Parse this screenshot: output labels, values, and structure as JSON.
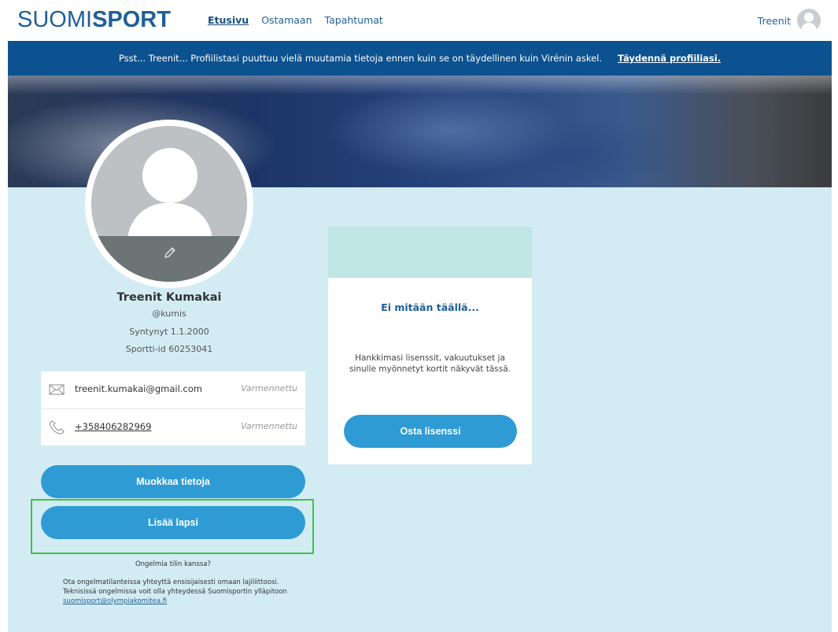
{
  "header": {
    "logo_light": "SUOMI",
    "logo_bold": "SPORT",
    "nav": [
      {
        "label": "Etusivu",
        "active": true
      },
      {
        "label": "Ostamaan",
        "active": false
      },
      {
        "label": "Tapahtumat",
        "active": false
      }
    ],
    "user_name": "Treenit"
  },
  "notice": {
    "text": "Psst... Treenit... Profiilistasi puuttuu vielä muutamia tietoja ennen kuin se on täydellinen kuin Virénin askel.",
    "link": "Täydennä profiiliasi."
  },
  "profile": {
    "name": "Treenit Kumakai",
    "handle": "@kumis",
    "born": "Syntynyt 1.1.2000",
    "sportti_id": "Sportti-id 60253041",
    "email": "treenit.kumakai@gmail.com",
    "email_status": "Varmennettu",
    "phone": "+358406282969",
    "phone_status": "Varmennettu",
    "edit_button": "Muokkaa tietoja",
    "add_child_button": "Lisää lapsi"
  },
  "help": {
    "title": "Ongelmia tilin kanssa?",
    "body": "Ota ongelmatilanteissa yhteyttä ensisijaisesti omaan lajiliittoosi. Teknisissä ongelmissa voit olla yhteydessä Suomisportin ylläpitoon",
    "email": "suomisport@olympiakomitea.fi"
  },
  "license": {
    "title": "Ei mitään täällä...",
    "description": "Hankkimasi lisenssit, vakuutukset ja sinulle myönnetyt kortit näkyvät tässä.",
    "button": "Osta lisenssi"
  },
  "colors": {
    "brand": "#1e5f97",
    "notice_bg": "#0c5290",
    "button": "#2f9bd5",
    "main_bg": "#d3ecf4",
    "highlight": "#3cc443"
  }
}
